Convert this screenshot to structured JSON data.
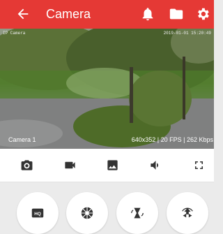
{
  "app_bar": {
    "title": "Camera",
    "background": "#e53935",
    "icons": [
      "arrow-back-icon",
      "bell-icon",
      "folder-icon",
      "gear-icon"
    ]
  },
  "video": {
    "camera_name": "Camera 1",
    "stream_info": "640x352 | 20 FPS | 262 Kbps",
    "osd_left": "IP Camera",
    "osd_right": "2019-01-01 15:20:49"
  },
  "toolbar": {
    "icons": [
      "camera-snapshot-icon",
      "video-record-icon",
      "gallery-icon",
      "volume-icon",
      "fullscreen-icon"
    ]
  },
  "controls": {
    "hq_label": "HQ",
    "icons": [
      "hq-icon",
      "aperture-icon",
      "hourglass-icon",
      "ptz-icon"
    ]
  }
}
